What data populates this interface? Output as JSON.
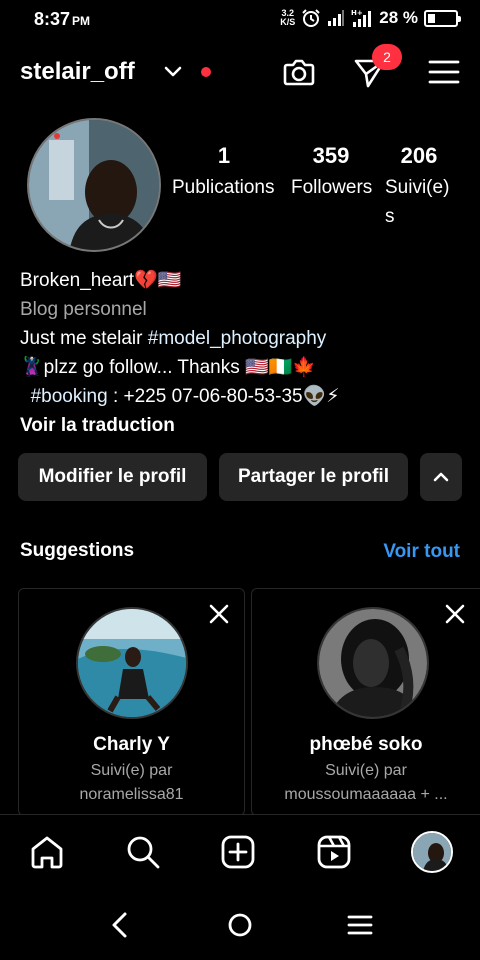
{
  "status_bar": {
    "time": "8:37",
    "ampm": "PM",
    "speed_value": "3.2",
    "speed_unit": "K/S",
    "battery": "28 %",
    "battery_level": 0.28,
    "icons": [
      "alarm-icon",
      "signal-icon",
      "signal-hplus-icon",
      "battery-icon"
    ]
  },
  "header": {
    "username": "stelair_off",
    "notification_count": "2",
    "icons": [
      "chevron-down-icon",
      "camera-icon",
      "direct-message-icon",
      "menu-icon"
    ]
  },
  "profile": {
    "stats": [
      {
        "value": "1",
        "label": "Publications"
      },
      {
        "value": "359",
        "label": "Followers"
      },
      {
        "value": "206",
        "label": "Suivi(e)s"
      }
    ],
    "name": "Broken_heart💔🇺🇸",
    "category": "Blog personnel",
    "bio_line1_text": "Just me stelair ",
    "bio_line1_tag": "#model_photography",
    "bio_line2": "🦹plzz go follow... Thanks 🇺🇸🇨🇮🍁",
    "bio_line3_tag": "#booking",
    "bio_line3_text": " : +225 07-06-80-53-35👽⚡",
    "translate": "Voir la traduction"
  },
  "buttons": {
    "edit": "Modifier le profil",
    "share": "Partager le profil"
  },
  "suggestions": {
    "title": "Suggestions",
    "see_all": "Voir tout",
    "cards": [
      {
        "name": "Charly Y",
        "followed_by": "Suivi(e) par",
        "follower": "noramelissa81"
      },
      {
        "name": "phœbé soko",
        "followed_by": "Suivi(e) par",
        "follower": "moussoumaaaaaa + ..."
      }
    ]
  },
  "tab_bar": [
    "home-icon",
    "search-icon",
    "create-icon",
    "reels-icon",
    "profile-avatar"
  ],
  "nav_bar": [
    "back-icon",
    "home-circle-icon",
    "recents-icon"
  ],
  "colors": {
    "background": "#000000",
    "button": "#262626",
    "link": "#3897f0",
    "badge": "#ff3040",
    "secondary_text": "#a8a8a8"
  }
}
